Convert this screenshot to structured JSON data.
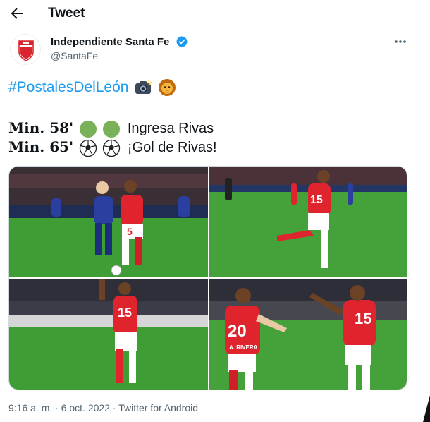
{
  "header": {
    "title": "Tweet",
    "back_icon": "arrow-left-icon"
  },
  "tweet": {
    "author_name": "Independiente Santa Fe",
    "handle": "@SantaFe",
    "verified": true,
    "more_icon": "more-horizontal-icon",
    "hashtag": "#PostalesDelLeón",
    "hashtag_emojis": [
      "camera-flash-icon",
      "lion-face-icon"
    ],
    "lines": [
      {
        "prefix": "Min. 58'",
        "icons": [
          "green-circle-icon",
          "green-circle-icon"
        ],
        "text": "Ingresa Rivas"
      },
      {
        "prefix": "Min. 65'",
        "icons": [
          "soccer-ball-icon",
          "soccer-ball-icon"
        ],
        "text": "¡Gol de Rivas!"
      }
    ],
    "photos": [
      {
        "name": "photo-1",
        "number": "5"
      },
      {
        "name": "photo-2",
        "number": "15"
      },
      {
        "name": "photo-3",
        "number": "15"
      },
      {
        "name": "photo-4",
        "number": "20",
        "number_2": "15",
        "name_label": "A. RIVERA"
      }
    ],
    "timestamp": "9:16 a. m. · 6 oct. 2022",
    "separator": " · ",
    "source": "Twitter for Android"
  },
  "colors": {
    "link": "#1d9bf0",
    "muted": "#536471",
    "jersey_red": "#e0242e",
    "rival_blue": "#2a3f9f",
    "pitch_green": "#3f9d35"
  }
}
